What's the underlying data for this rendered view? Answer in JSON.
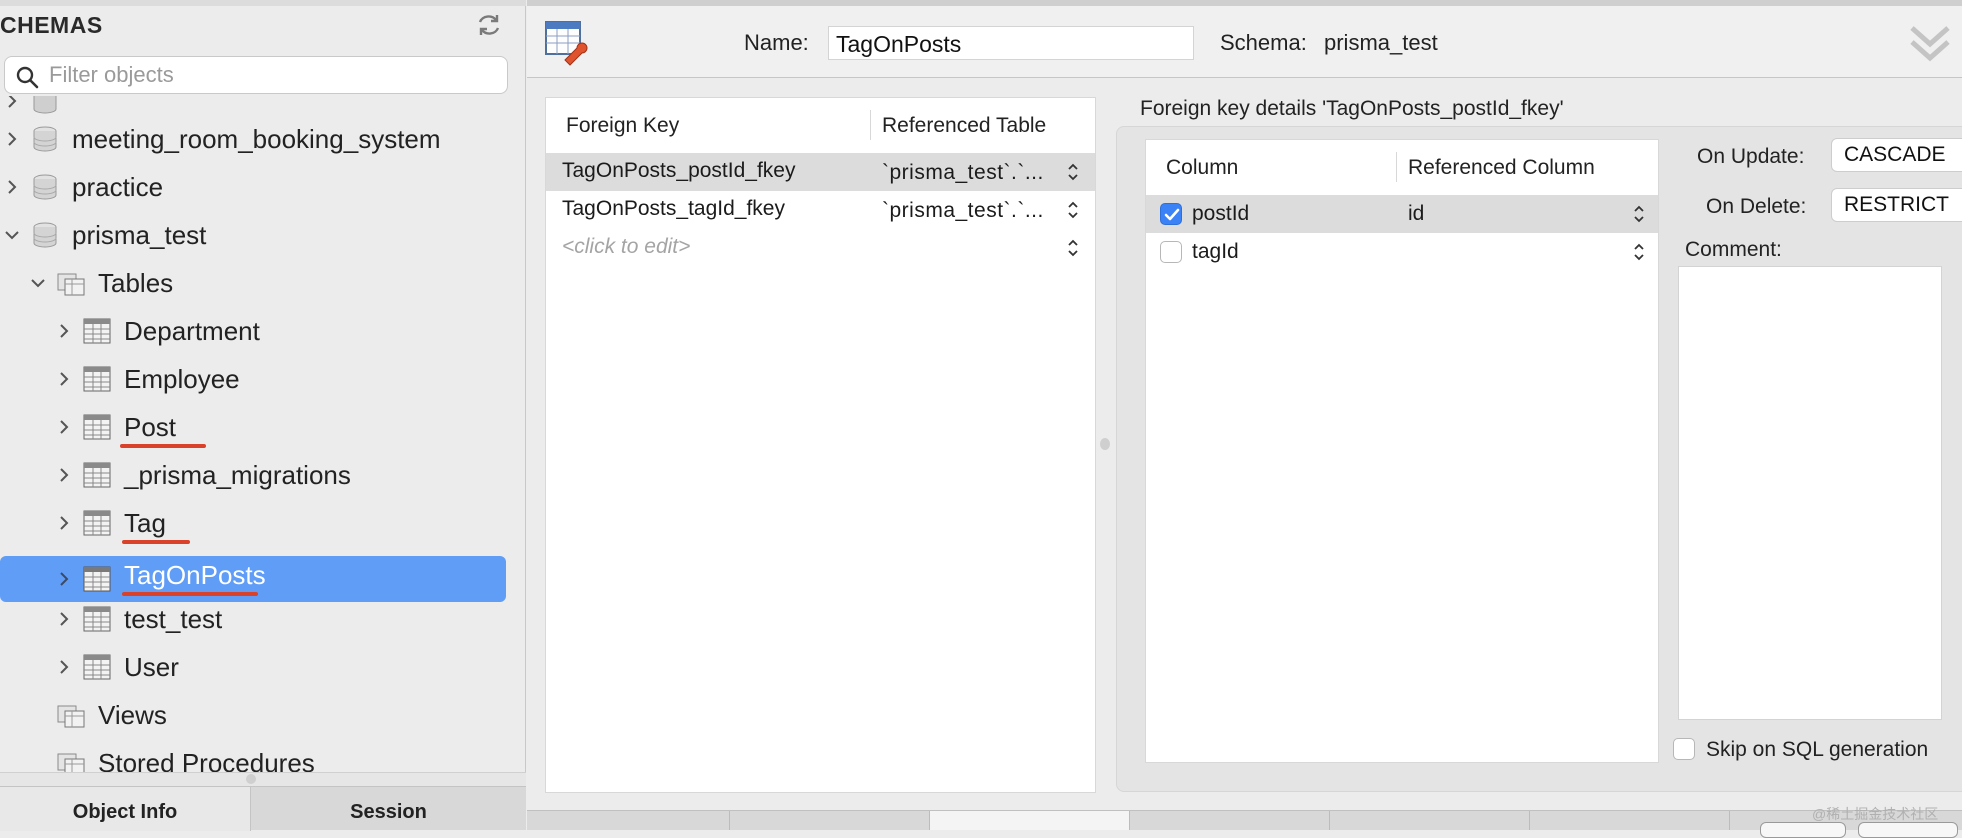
{
  "sidebar": {
    "title": "CHEMAS",
    "filter_placeholder": "Filter objects",
    "schemas_partial": "",
    "items": [
      {
        "label": "meeting_room_booking_system",
        "type": "schema"
      },
      {
        "label": "practice",
        "type": "schema"
      },
      {
        "label": "prisma_test",
        "type": "schema",
        "expanded": true
      },
      {
        "label": "Tables",
        "type": "folder",
        "expanded": true
      },
      {
        "label": "Department",
        "type": "table"
      },
      {
        "label": "Employee",
        "type": "table"
      },
      {
        "label": "Post",
        "type": "table",
        "underlined": true
      },
      {
        "label": "_prisma_migrations",
        "type": "table"
      },
      {
        "label": "Tag",
        "type": "table",
        "underlined": true
      },
      {
        "label": "TagOnPosts",
        "type": "table",
        "selected": true,
        "underlined": true
      },
      {
        "label": "test_test",
        "type": "table"
      },
      {
        "label": "User",
        "type": "table"
      },
      {
        "label": "Views",
        "type": "folder"
      },
      {
        "label": "Stored Procedures",
        "type": "folder"
      }
    ],
    "tabs": {
      "object_info": "Object Info",
      "session": "Session"
    }
  },
  "header": {
    "name_label": "Name:",
    "name_value": "TagOnPosts",
    "schema_label": "Schema:",
    "schema_value": "prisma_test"
  },
  "foreign_keys": {
    "columns": [
      "Foreign Key",
      "Referenced Table"
    ],
    "rows": [
      {
        "name": "TagOnPosts_postId_fkey",
        "ref": "`prisma_test`.`...",
        "selected": true
      },
      {
        "name": "TagOnPosts_tagId_fkey",
        "ref": "`prisma_test`.`..."
      },
      {
        "name": "<click to edit>",
        "ref": "",
        "placeholder": true
      }
    ]
  },
  "details": {
    "title": "Foreign key details 'TagOnPosts_postId_fkey'",
    "columns": [
      "Column",
      "Referenced Column"
    ],
    "rows": [
      {
        "column": "postId",
        "ref": "id",
        "checked": true
      },
      {
        "column": "tagId",
        "ref": "",
        "checked": false
      }
    ],
    "on_update_label": "On Update:",
    "on_update_value": "CASCADE",
    "on_delete_label": "On Delete:",
    "on_delete_value": "RESTRICT",
    "comment_label": "Comment:",
    "skip_label": "Skip on SQL generation",
    "skip_checked": false
  },
  "watermark": "@稀土掘金技术社区",
  "colors": {
    "selection": "#5f9df7",
    "underline": "#d9412b",
    "checkbox_on": "#3b82f6"
  }
}
